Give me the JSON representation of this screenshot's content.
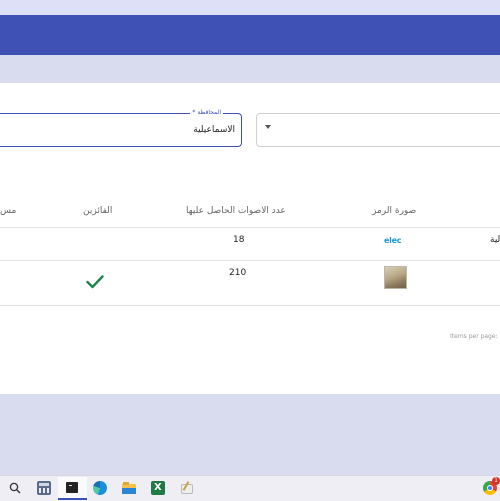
{
  "filters": {
    "governorate_label": "المحافظة *",
    "governorate_value": "الاسماعيلية"
  },
  "table": {
    "headers": {
      "col_truncated": "مس",
      "winners": "الفائزين",
      "votes": "عدد الاصوات الحاصل عليها",
      "symbol_image": "صورة الرمز"
    },
    "rows": [
      {
        "votes": "18",
        "logo_text": "elec",
        "name_truncated": "لية",
        "winner": false
      },
      {
        "votes": "210",
        "logo_text": "",
        "name_truncated": "",
        "winner": true
      }
    ]
  },
  "paginator": {
    "items_per_page": "Items per page:"
  },
  "colors": {
    "appbar": "#3f51b5",
    "winner_check": "#1e8449"
  },
  "taskbar": {
    "icons": [
      "search-icon",
      "calculator-icon",
      "terminal-icon",
      "edge-icon",
      "file-explorer-icon",
      "excel-icon",
      "paint-icon",
      "chrome-icon"
    ],
    "notification_badge": "1"
  }
}
